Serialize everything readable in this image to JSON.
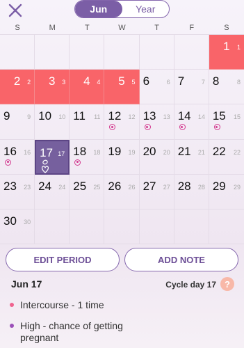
{
  "header": {
    "close_icon": "x-icon",
    "tabs": [
      {
        "label": "Jun",
        "active": true
      },
      {
        "label": "Year",
        "active": false
      }
    ]
  },
  "weekdays": [
    "S",
    "M",
    "T",
    "W",
    "T",
    "F",
    "S"
  ],
  "calendar": {
    "rows": [
      [
        {
          "d": ""
        },
        {
          "d": ""
        },
        {
          "d": ""
        },
        {
          "d": ""
        },
        {
          "d": ""
        },
        {
          "d": ""
        },
        {
          "d": "1",
          "c": "1",
          "period": true
        }
      ],
      [
        {
          "d": "2",
          "c": "2",
          "period": true
        },
        {
          "d": "3",
          "c": "3",
          "period": true
        },
        {
          "d": "4",
          "c": "4",
          "period": true
        },
        {
          "d": "5",
          "c": "5",
          "period": true
        },
        {
          "d": "6",
          "c": "6"
        },
        {
          "d": "7",
          "c": "7"
        },
        {
          "d": "8",
          "c": "8"
        }
      ],
      [
        {
          "d": "9",
          "c": "9"
        },
        {
          "d": "10",
          "c": "10"
        },
        {
          "d": "11",
          "c": "11"
        },
        {
          "d": "12",
          "c": "12",
          "fertile": true
        },
        {
          "d": "13",
          "c": "13",
          "fertile": true
        },
        {
          "d": "14",
          "c": "14",
          "fertile": true
        },
        {
          "d": "15",
          "c": "15",
          "fertile": true
        }
      ],
      [
        {
          "d": "16",
          "c": "16",
          "fertile": true
        },
        {
          "d": "17",
          "c": "17",
          "selected": true
        },
        {
          "d": "18",
          "c": "18",
          "fertile": true
        },
        {
          "d": "19",
          "c": "19"
        },
        {
          "d": "20",
          "c": "20"
        },
        {
          "d": "21",
          "c": "21"
        },
        {
          "d": "22",
          "c": "22"
        }
      ],
      [
        {
          "d": "23",
          "c": "23"
        },
        {
          "d": "24",
          "c": "24"
        },
        {
          "d": "25",
          "c": "25"
        },
        {
          "d": "26",
          "c": "26"
        },
        {
          "d": "27",
          "c": "27"
        },
        {
          "d": "28",
          "c": "28"
        },
        {
          "d": "29",
          "c": "29"
        }
      ],
      [
        {
          "d": "30",
          "c": "30"
        },
        {
          "d": ""
        },
        {
          "d": ""
        },
        {
          "d": ""
        },
        {
          "d": ""
        },
        {
          "d": ""
        },
        {
          "d": ""
        }
      ]
    ]
  },
  "actions": {
    "edit_period": "EDIT PERIOD",
    "add_note": "ADD NOTE"
  },
  "detail": {
    "date": "Jun 17",
    "cycle_day": "Cycle day 17",
    "help": "?",
    "notes": [
      "Intercourse - 1 time",
      "High - chance of getting pregnant"
    ]
  },
  "colors": {
    "accent": "#7b5ea6",
    "period": "#f96469",
    "fertile_marker": "#d3398f"
  }
}
